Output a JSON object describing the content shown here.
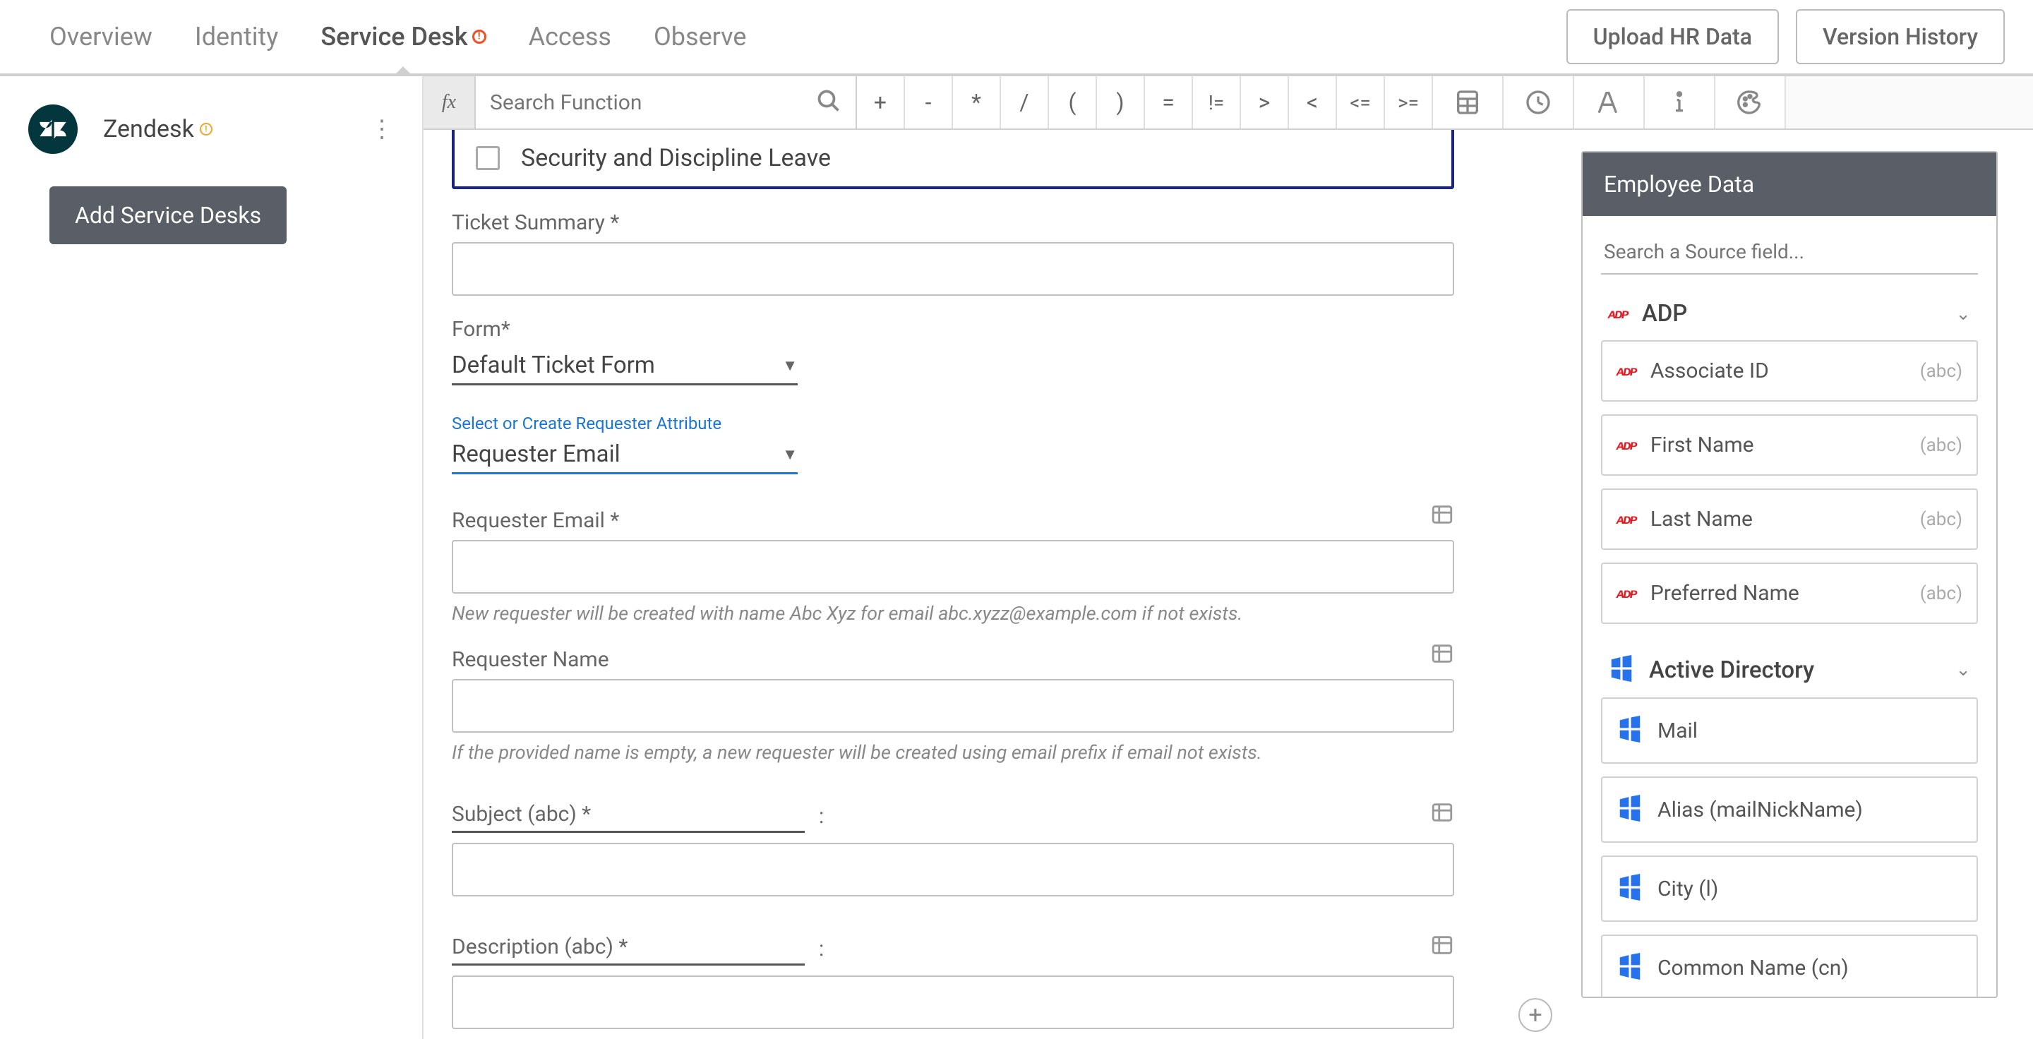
{
  "tabs": [
    "Overview",
    "Identity",
    "Service Desk",
    "Access",
    "Observe"
  ],
  "active_tab": 2,
  "top_buttons": {
    "upload": "Upload HR Data",
    "version": "Version History"
  },
  "sidebar": {
    "app_name": "Zendesk",
    "add_btn": "Add Service Desks"
  },
  "toolbar": {
    "search_placeholder": "Search Function",
    "ops": [
      "+",
      "-",
      "*",
      "/",
      "(",
      ")",
      "=",
      "!=",
      ">",
      "<",
      "<=",
      ">="
    ]
  },
  "form": {
    "check_label": "Security and Discipline Leave",
    "ticket_summary": "Ticket Summary *",
    "form_lbl": "Form*",
    "form_val": "Default Ticket Form",
    "req_attr_lbl": "Select or Create Requester Attribute",
    "req_attr_val": "Requester Email",
    "req_email_lbl": "Requester Email *",
    "req_email_hint": "New requester will be created with name Abc Xyz for email abc.xyzz@example.com if not exists.",
    "req_name_lbl": "Requester Name",
    "req_name_hint": "If the provided name is empty, a new requester will be created using email prefix if email not exists.",
    "subject_lbl": "Subject (abc) *",
    "desc_lbl": "Description (abc) *",
    "colon": ":"
  },
  "data_panel": {
    "title": "Employee Data",
    "search_placeholder": "Search a Source field...",
    "sources": [
      {
        "name": "ADP",
        "icon": "adp",
        "fields": [
          {
            "name": "Associate ID",
            "type": "(abc)"
          },
          {
            "name": "First Name",
            "type": "(abc)"
          },
          {
            "name": "Last Name",
            "type": "(abc)"
          },
          {
            "name": "Preferred Name",
            "type": "(abc)"
          }
        ]
      },
      {
        "name": "Active Directory",
        "icon": "ad",
        "fields": [
          {
            "name": "Mail",
            "type": ""
          },
          {
            "name": "Alias (mailNickName)",
            "type": ""
          },
          {
            "name": "City (l)",
            "type": ""
          },
          {
            "name": "Common Name (cn)",
            "type": ""
          }
        ]
      }
    ]
  }
}
